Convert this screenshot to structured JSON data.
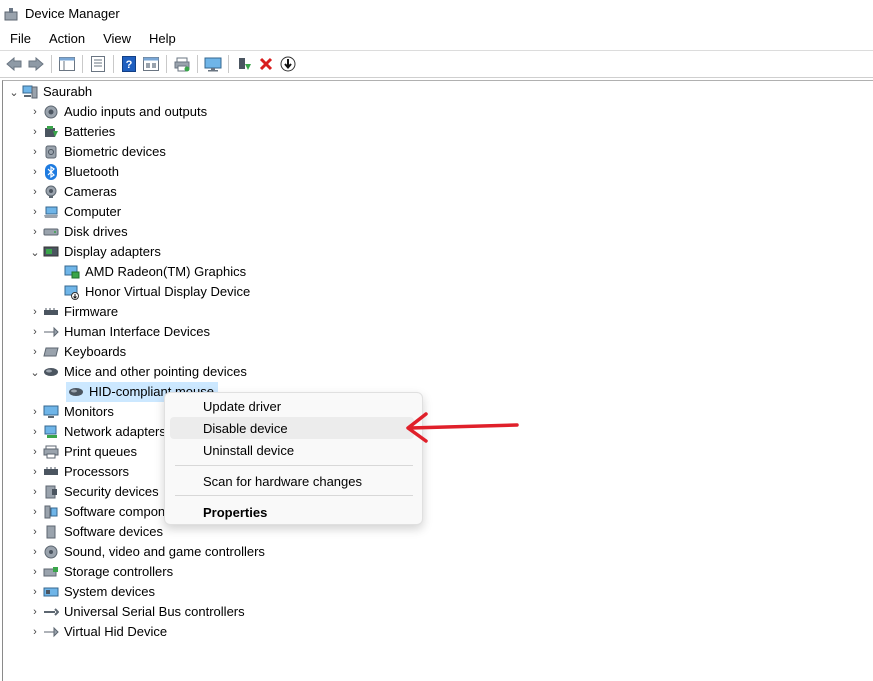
{
  "window": {
    "title": "Device Manager"
  },
  "menubar": {
    "items": [
      "File",
      "Action",
      "View",
      "Help"
    ]
  },
  "tree": {
    "root": "Saurabh",
    "categories": {
      "audio": "Audio inputs and outputs",
      "batteries": "Batteries",
      "biometric": "Biometric devices",
      "bluetooth": "Bluetooth",
      "cameras": "Cameras",
      "computer": "Computer",
      "disk": "Disk drives",
      "display": "Display adapters",
      "display_child1": "AMD Radeon(TM) Graphics",
      "display_child2": "Honor Virtual Display Device",
      "firmware": "Firmware",
      "hid": "Human Interface Devices",
      "keyboards": "Keyboards",
      "mice": "Mice and other pointing devices",
      "mice_child": "HID-compliant mouse",
      "monitors": "Monitors",
      "network": "Network adapters",
      "print": "Print queues",
      "processors": "Processors",
      "security": "Security devices",
      "software_comp": "Software components",
      "software_dev": "Software devices",
      "sound": "Sound, video and game controllers",
      "storage": "Storage controllers",
      "system": "System devices",
      "usb": "Universal Serial Bus controllers",
      "vhid": "Virtual Hid Device"
    }
  },
  "context_menu": {
    "update": "Update driver",
    "disable": "Disable device",
    "uninstall": "Uninstall device",
    "scan": "Scan for hardware changes",
    "properties": "Properties"
  },
  "colors": {
    "selection": "#cce8ff",
    "annotation_arrow": "#e0202a",
    "bluetooth": "#1e7be0"
  }
}
